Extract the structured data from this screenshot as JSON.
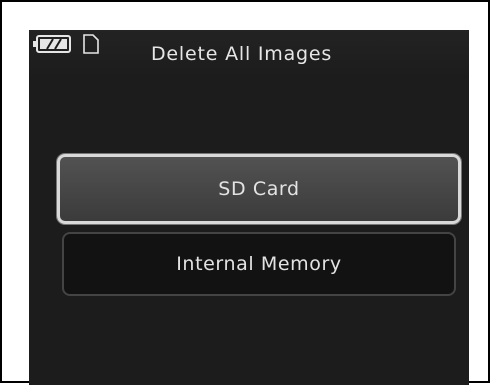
{
  "screen": {
    "title": "Delete All Images",
    "status_icons": [
      "battery-icon",
      "sd-card-icon"
    ]
  },
  "menu": {
    "items": [
      {
        "label": "SD Card",
        "selected": true
      },
      {
        "label": "Internal Memory",
        "selected": false
      }
    ]
  },
  "colors": {
    "background": "#1c1c1c",
    "selected_fill": "#4a4a4a",
    "selected_border": "#d9d9d9",
    "text": "#e3e3e3"
  }
}
